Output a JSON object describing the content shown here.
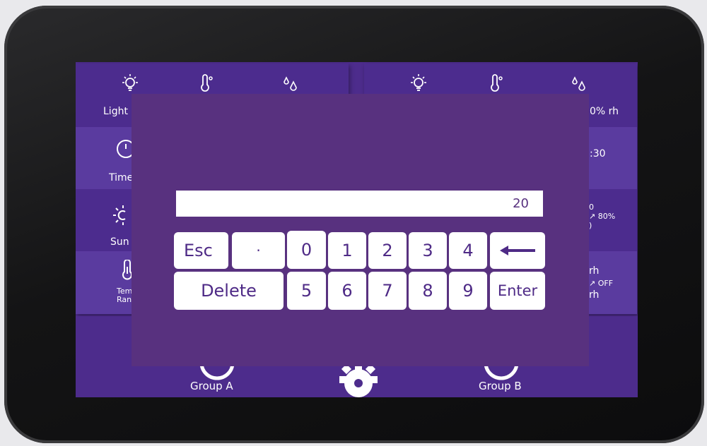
{
  "colors": {
    "screen_bg": "#4d2c8c",
    "dialog_bg": "#58317f",
    "key_bg": "#ffffff",
    "key_text": "#4e2a86"
  },
  "panels": {
    "left": {
      "r1_label": "Light",
      "r2_label": "Time",
      "r3_label": "Sun",
      "r4_line1": "Tem",
      "r4_line2": "Ran"
    },
    "right": {
      "r1_value": "0% rh",
      "r2_value": ":30",
      "r3_line1": "0",
      "r3_line2": "↗ 80%",
      "r3_line3": ")",
      "r4_line1": "rh",
      "r4_line2": "↗ OFF",
      "r4_line3": "rh"
    }
  },
  "bottom": {
    "group_a_label": "Group A",
    "group_b_label": "Group B"
  },
  "keypad": {
    "input_value": "20",
    "keys": {
      "esc": "Esc",
      "dot": "·",
      "k0": "0",
      "k1": "1",
      "k2": "2",
      "k3": "3",
      "k4": "4",
      "k5": "5",
      "k6": "6",
      "k7": "7",
      "k8": "8",
      "k9": "9",
      "delete": "Delete",
      "enter": "Enter"
    },
    "icons": {
      "backspace": "arrow-left-icon"
    }
  }
}
